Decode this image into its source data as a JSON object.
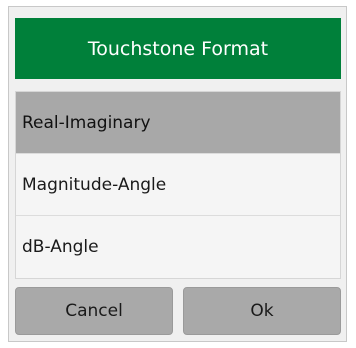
{
  "dialog": {
    "title": "Touchstone Format",
    "options": [
      {
        "label": "Real-Imaginary",
        "selected": true
      },
      {
        "label": "Magnitude-Angle",
        "selected": false
      },
      {
        "label": "dB-Angle",
        "selected": false
      }
    ],
    "cancel_label": "Cancel",
    "ok_label": "Ok"
  },
  "colors": {
    "title_bar": "#00803a",
    "selected_option": "#a8a8a8",
    "button": "#a9a9a9",
    "dialog_background": "#f0f0f0"
  }
}
